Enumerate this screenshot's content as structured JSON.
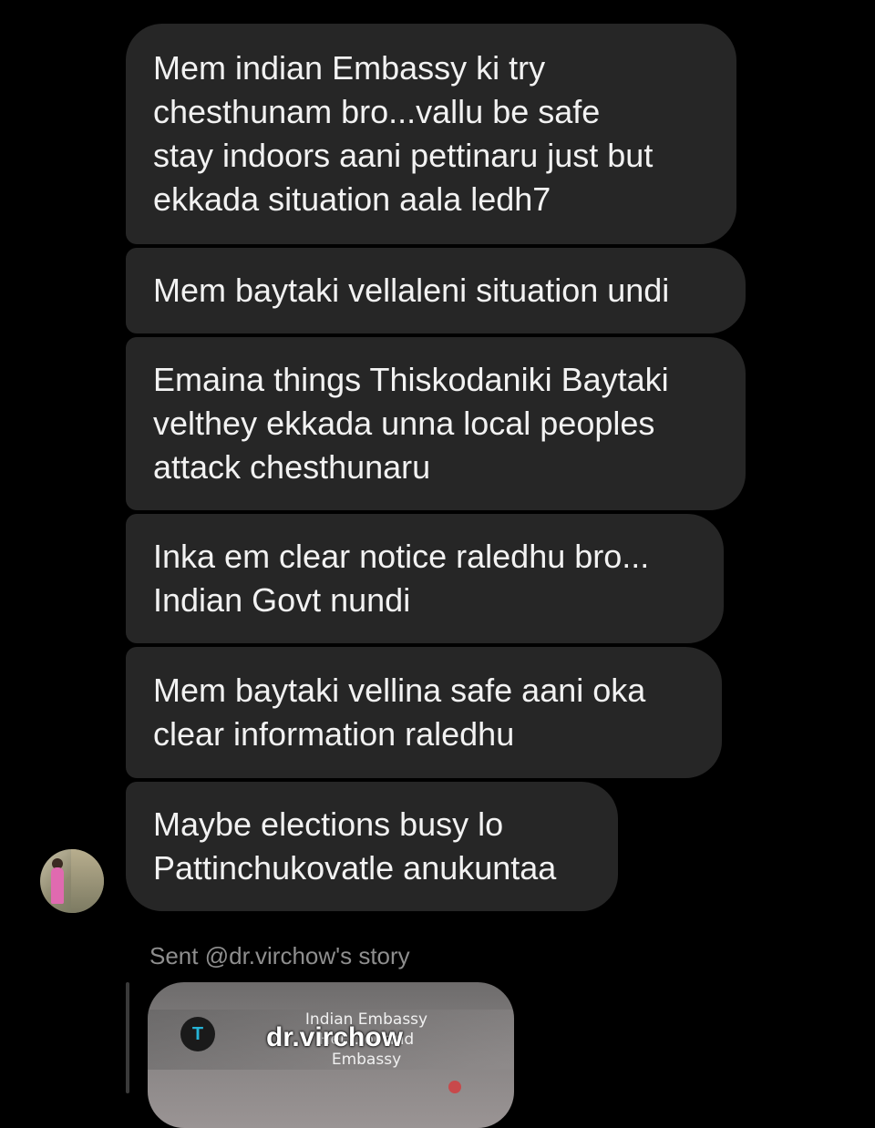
{
  "messages": [
    {
      "lines": [
        "Mem indian Embassy ki try",
        "chesthunam bro...vallu be safe",
        "stay indoors aani pettinaru just but",
        "ekkada situation aala ledh7"
      ]
    },
    {
      "lines": [
        "Mem baytaki vellaleni situation undi"
      ]
    },
    {
      "lines": [
        "Emaina things Thiskodaniki Baytaki",
        "velthey ekkada unna local peoples",
        "attack chesthunaru"
      ]
    },
    {
      "lines": [
        "Inka em clear notice raledhu bro...",
        "Indian Govt nundi"
      ]
    },
    {
      "lines": [
        "Mem baytaki vellina safe aani oka",
        "clear information raledhu"
      ]
    },
    {
      "lines": [
        "Maybe elections busy lo",
        "Pattinchukovatle anukuntaa"
      ]
    }
  ],
  "story_share": {
    "sent_label": "Sent @dr.virchow's story",
    "handle": "dr.virchow",
    "caption_lines": [
      "Indian Embassy",
      "Hel... or and",
      "Embassy"
    ]
  },
  "colors": {
    "background": "#000000",
    "bubble": "#262626",
    "text": "#f2f2f2",
    "muted": "#8e8e8e"
  }
}
